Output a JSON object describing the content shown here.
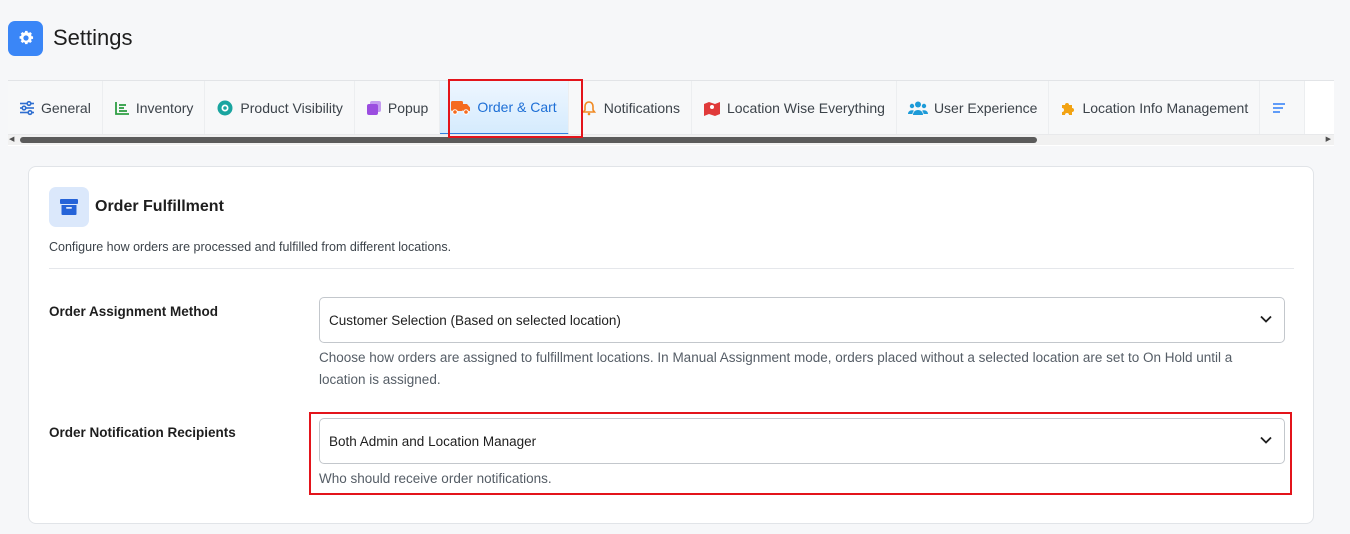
{
  "header": {
    "title": "Settings",
    "icon": "gear-icon"
  },
  "tabs": [
    {
      "label": "General",
      "icon": "sliders-icon",
      "color": "#2f6fd0"
    },
    {
      "label": "Inventory",
      "icon": "chart-icon",
      "color": "#2f9e44"
    },
    {
      "label": "Product Visibility",
      "icon": "eye-icon",
      "color": "#1aa5a0"
    },
    {
      "label": "Popup",
      "icon": "layers-icon",
      "color": "#9b4de0"
    },
    {
      "label": "Order & Cart",
      "icon": "truck-icon",
      "color": "#f56b1f",
      "active": true
    },
    {
      "label": "Notifications",
      "icon": "bell-icon",
      "color": "#f08a24"
    },
    {
      "label": "Location Wise Everything",
      "icon": "map-icon",
      "color": "#e03a3a"
    },
    {
      "label": "User Experience",
      "icon": "users-icon",
      "color": "#1d9bd8"
    },
    {
      "label": "Location Info Management",
      "icon": "puzzle-icon",
      "color": "#f2a313"
    },
    {
      "label": "",
      "icon": "list-icon",
      "color": "#3a86f7"
    }
  ],
  "card": {
    "title": "Order Fulfillment",
    "icon": "archive-icon",
    "description": "Configure how orders are processed and fulfilled from different locations."
  },
  "fields": {
    "assignment": {
      "label": "Order Assignment Method",
      "value": "Customer Selection (Based on selected location)",
      "help": "Choose how orders are assigned to fulfillment locations. In Manual Assignment mode, orders placed without a selected location are set to On Hold until a location is assigned."
    },
    "recipients": {
      "label": "Order Notification Recipients",
      "value": "Both Admin and Location Manager",
      "help": "Who should receive order notifications."
    }
  },
  "colors": {
    "accent": "#3a86f7",
    "highlight": "#e3141b",
    "active_tab_text": "#1d6fd6"
  }
}
